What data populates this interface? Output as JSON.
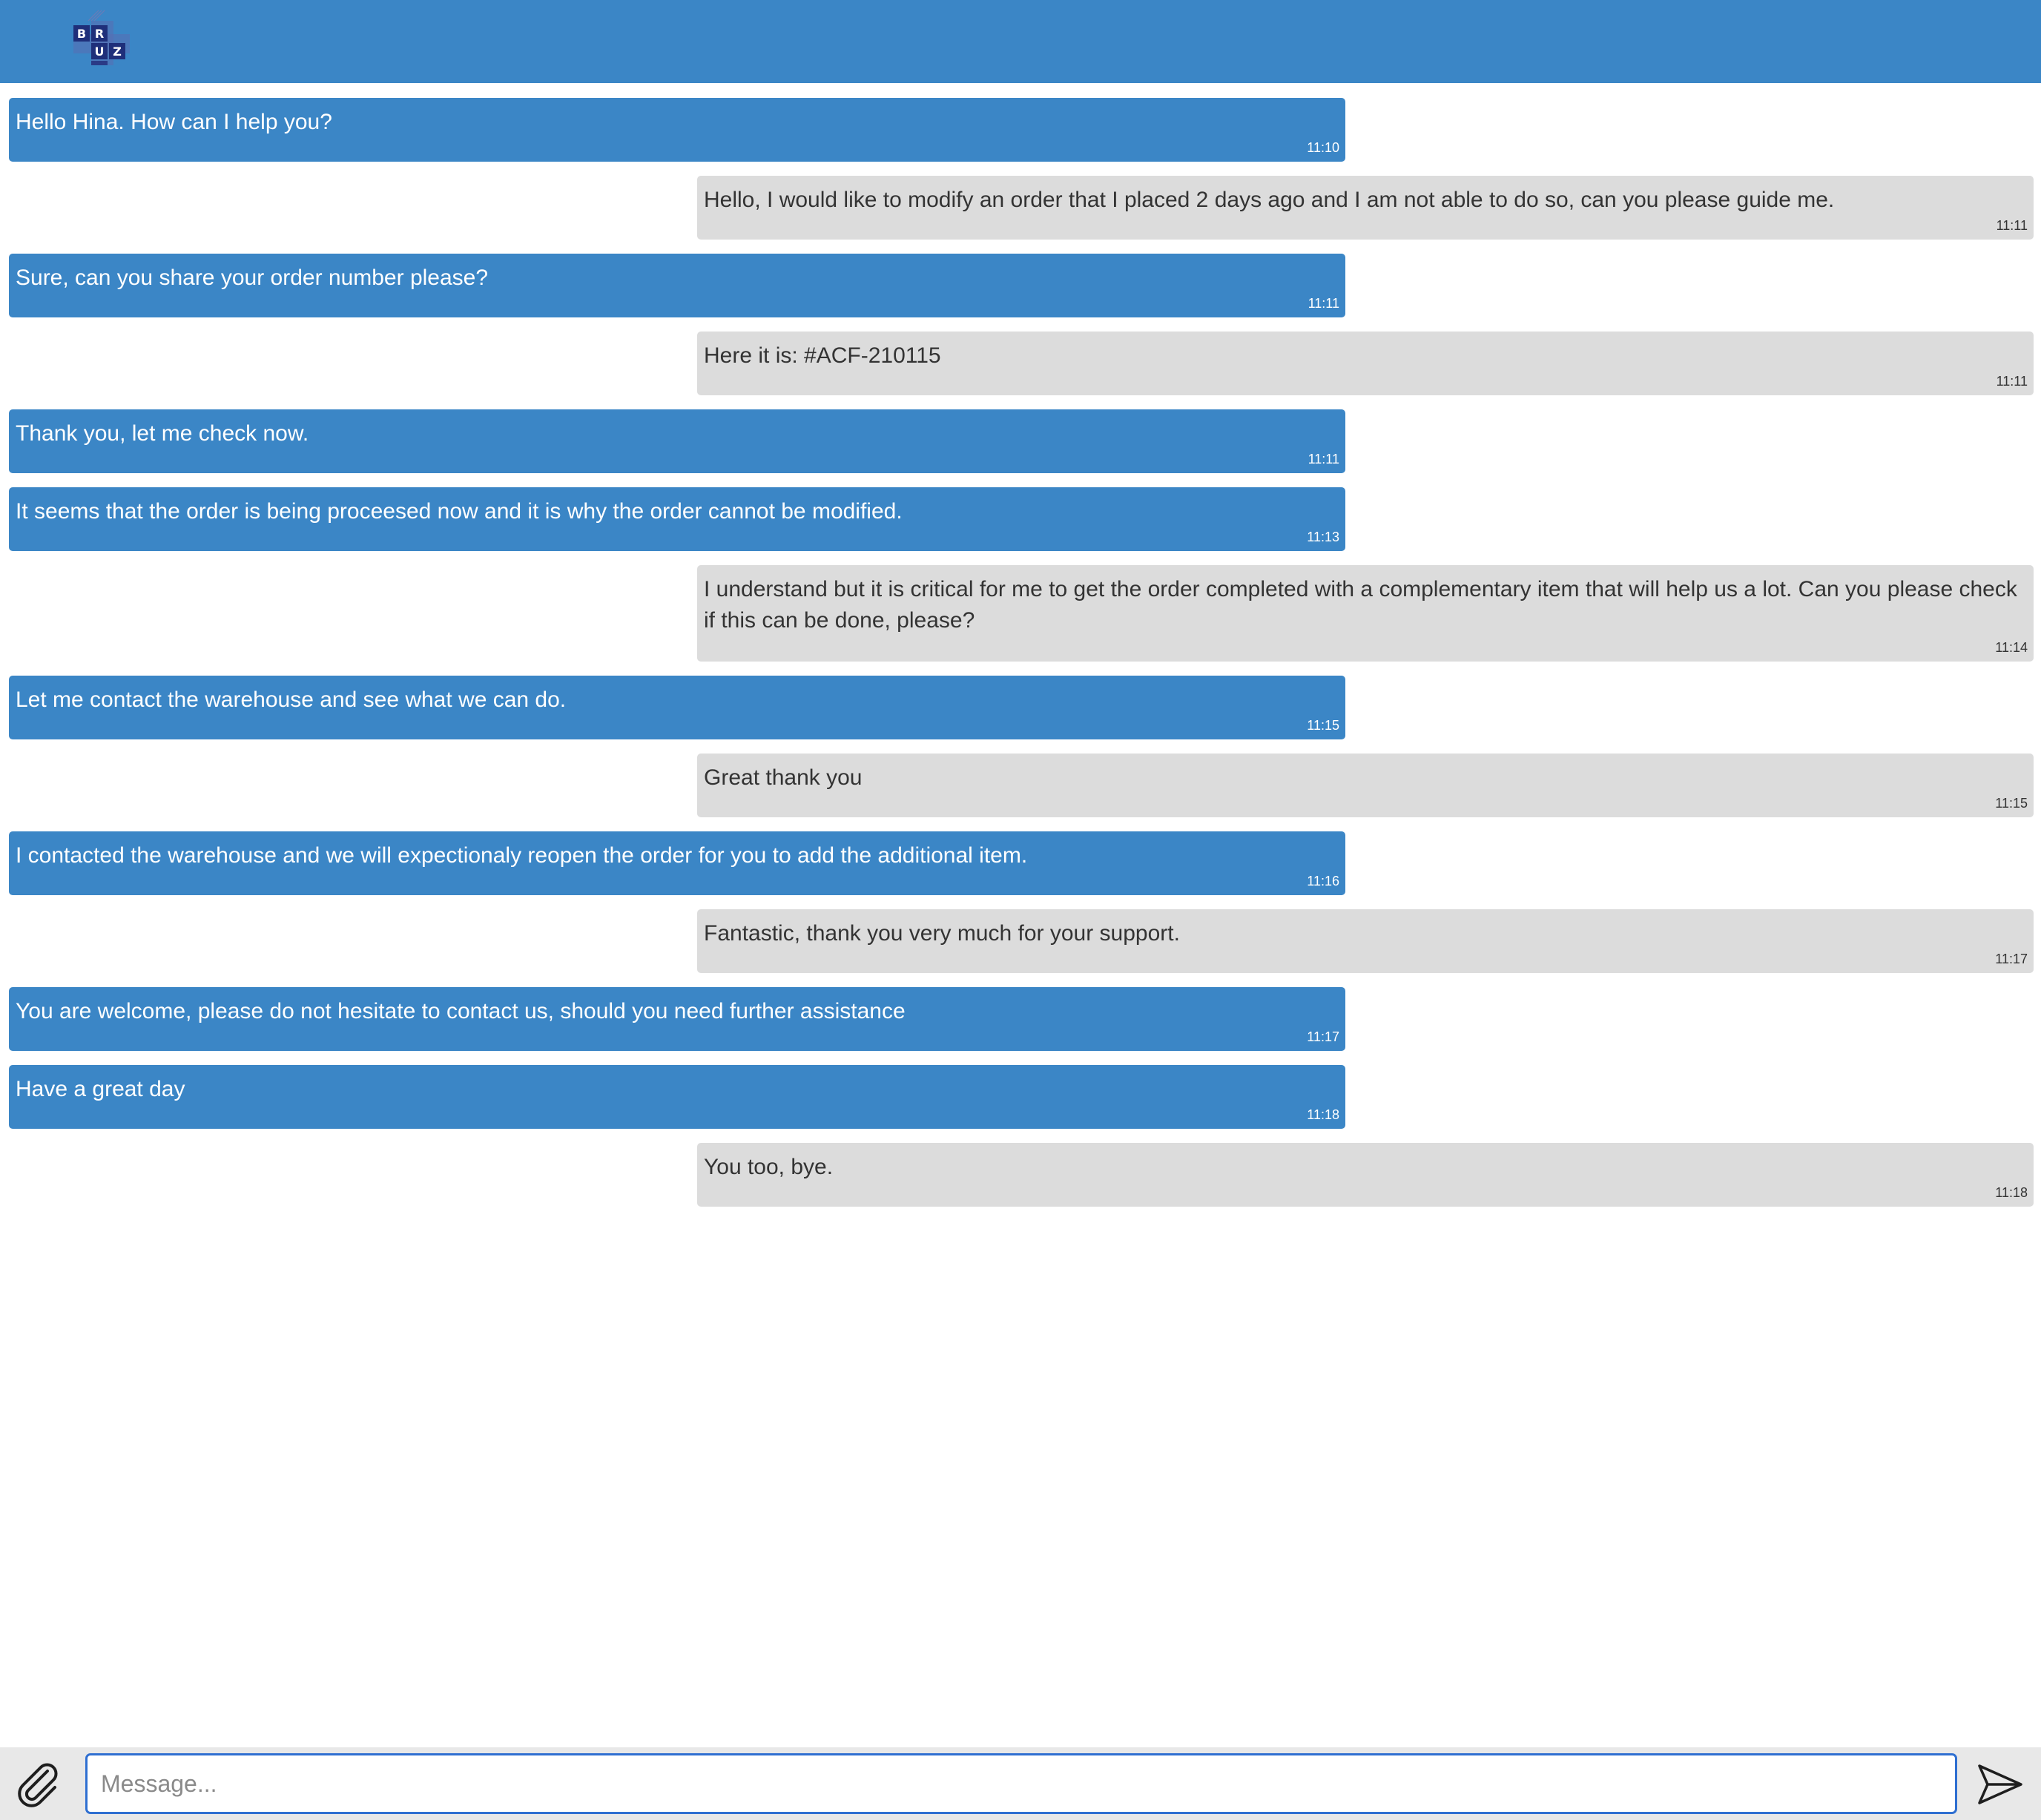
{
  "composer": {
    "placeholder": "Message...",
    "attach_icon": "paperclip-icon",
    "send_icon": "send-arrow-icon"
  },
  "logo": {
    "letters": [
      "B",
      "R",
      "U",
      "Z"
    ]
  },
  "colors": {
    "accent": "#3b86c6",
    "user_bubble": "#dcdcdc"
  },
  "messages": [
    {
      "side": "agent",
      "text": "Hello Hina. How can I help you?",
      "time": "11:10"
    },
    {
      "side": "user",
      "text": "Hello, I would like to modify an order that I placed 2 days ago and I am not able to do so, can you please guide me.",
      "time": "11:11"
    },
    {
      "side": "agent",
      "text": "Sure, can you share your order number please?",
      "time": "11:11"
    },
    {
      "side": "user",
      "text": "Here it is: #ACF-210115",
      "time": "11:11"
    },
    {
      "side": "agent",
      "text": "Thank you, let me check now.",
      "time": "11:11"
    },
    {
      "side": "agent",
      "text": "It seems that the order is being proceesed now and it is why the order cannot be modified.",
      "time": "11:13"
    },
    {
      "side": "user",
      "text": "I understand but it is critical for me to get the order completed with a complementary item that will help us a lot. Can you please check if this can be done, please?",
      "time": "11:14"
    },
    {
      "side": "agent",
      "text": "Let me contact the warehouse and see what we can do.",
      "time": "11:15"
    },
    {
      "side": "user",
      "text": "Great thank you",
      "time": "11:15"
    },
    {
      "side": "agent",
      "text": "I contacted the warehouse and we will expectionaly reopen the order for you to add the additional item.",
      "time": "11:16"
    },
    {
      "side": "user",
      "text": "Fantastic, thank you very much for your support.",
      "time": "11:17"
    },
    {
      "side": "agent",
      "text": "You are welcome, please do not hesitate to contact us, should you need further assistance",
      "time": "11:17"
    },
    {
      "side": "agent",
      "text": "Have a great day",
      "time": "11:18"
    },
    {
      "side": "user",
      "text": "You too, bye.",
      "time": "11:18"
    }
  ]
}
